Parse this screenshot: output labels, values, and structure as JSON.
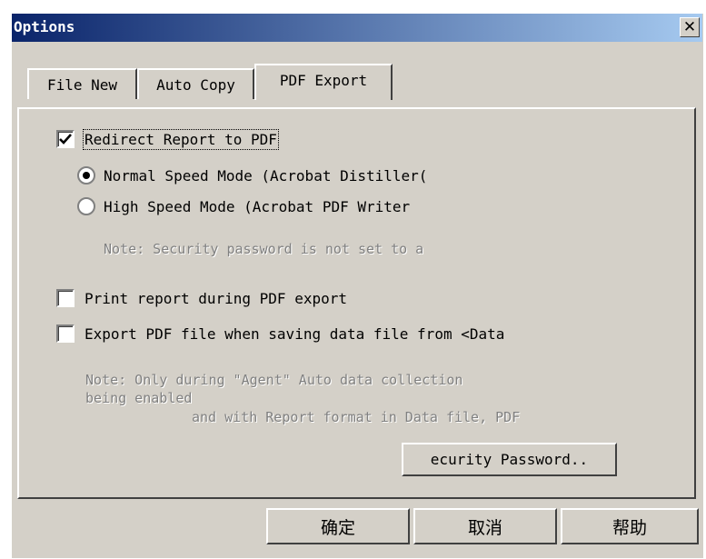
{
  "window": {
    "title": "Options"
  },
  "title_bar": {
    "close_glyph": "✕"
  },
  "tabs": [
    {
      "label": "File New",
      "active": false
    },
    {
      "label": "Auto Copy",
      "active": false
    },
    {
      "label": "PDF Export",
      "active": true
    }
  ],
  "pdf_export": {
    "redirect": {
      "label": "Redirect Report to PDF",
      "checked": true
    },
    "modes": [
      {
        "label": "Normal Speed Mode (Acrobat Distiller(",
        "selected": true
      },
      {
        "label": "High Speed Mode (Acrobat PDF Writer",
        "selected": false
      }
    ],
    "security_note": "Note: Security password is not set to a",
    "print_report": {
      "label": "Print report during PDF export",
      "checked": false
    },
    "export_on_save": {
      "label": "Export PDF file when saving data file from <Data",
      "checked": false
    },
    "agent_note": {
      "line1": "Note: Only during \"Agent\" Auto data collection",
      "line2": "being enabled",
      "line3": "and with Report format in Data file, PDF"
    },
    "security_password_button": "ecurity Password.."
  },
  "footer": {
    "ok_label": "确定",
    "cancel_label": "取消",
    "help_label": "帮助"
  }
}
